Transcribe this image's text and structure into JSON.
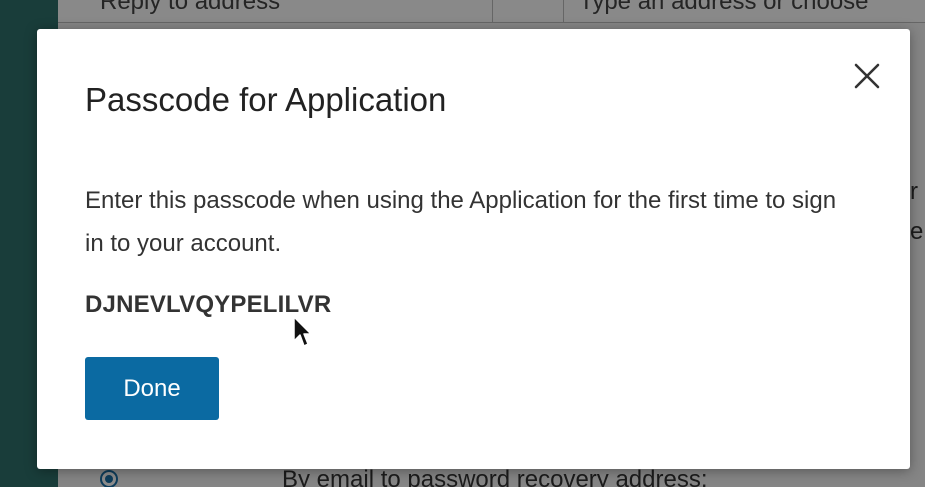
{
  "background": {
    "reply_to_label": "Reply to address",
    "address_placeholder": "Type an address or choose",
    "recovery_option": "By email to password recovery address:",
    "side_fragment_1": "r",
    "side_fragment_2": "e"
  },
  "modal": {
    "title": "Passcode for Application",
    "description": "Enter this passcode when using the Application for the first time to sign in to your account.",
    "passcode": "DJNEVLVQYPELILVR",
    "done_label": "Done",
    "close_icon": "close-icon"
  },
  "colors": {
    "primary_button": "#0b6aa2",
    "backdrop": "#2e6f6a"
  }
}
